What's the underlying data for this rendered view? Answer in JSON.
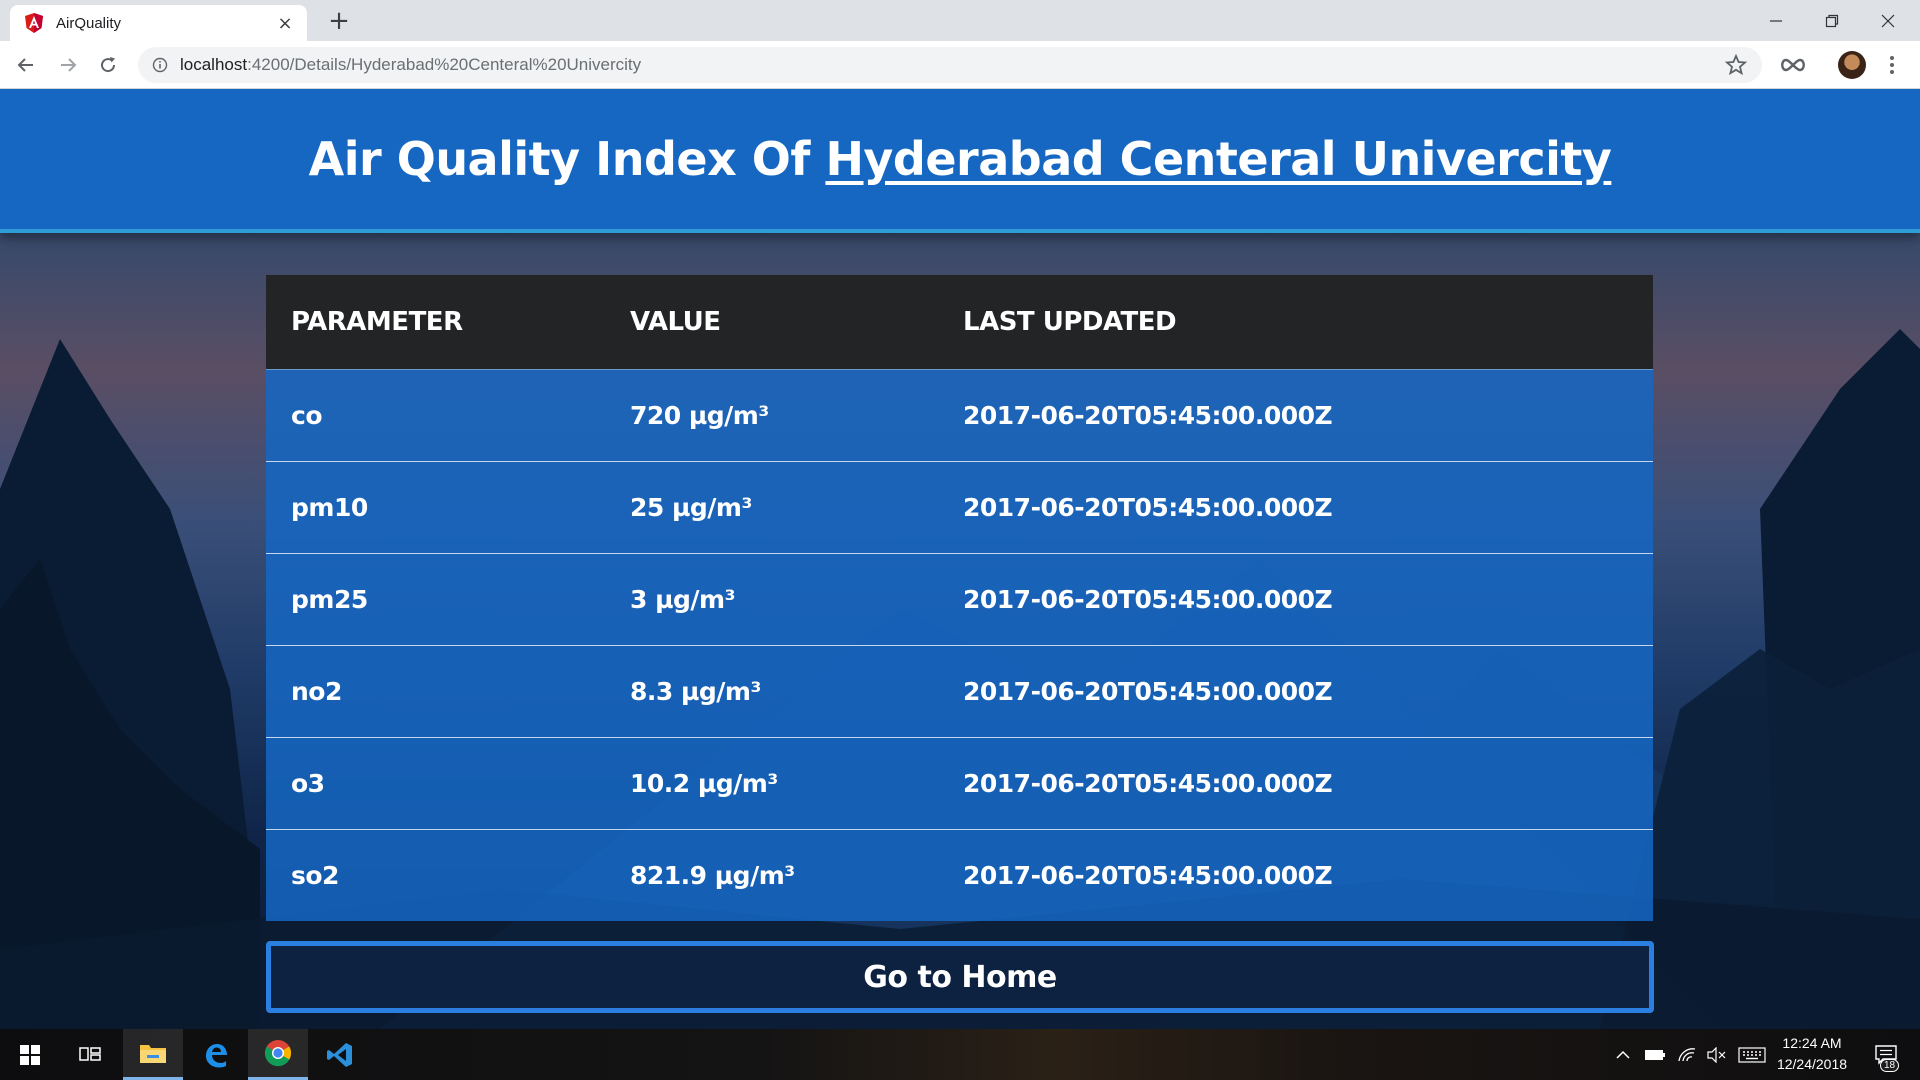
{
  "browser": {
    "tab_title": "AirQuality",
    "tab_close": "×",
    "new_tab": "+",
    "url_host": "localhost",
    "url_path": ":4200/Details/Hyderabad%20Centeral%20Univercity"
  },
  "page": {
    "title_prefix": "Air Quality Index Of ",
    "title_city": "Hyderabad Centeral Univercity",
    "table": {
      "headers": [
        "PARAMETER",
        "VALUE",
        "LAST UPDATED"
      ],
      "rows": [
        {
          "parameter": "co",
          "value": "720 µg/m³",
          "last_updated": "2017-06-20T05:45:00.000Z"
        },
        {
          "parameter": "pm10",
          "value": "25 µg/m³",
          "last_updated": "2017-06-20T05:45:00.000Z"
        },
        {
          "parameter": "pm25",
          "value": "3 µg/m³",
          "last_updated": "2017-06-20T05:45:00.000Z"
        },
        {
          "parameter": "no2",
          "value": "8.3 µg/m³",
          "last_updated": "2017-06-20T05:45:00.000Z"
        },
        {
          "parameter": "o3",
          "value": "10.2 µg/m³",
          "last_updated": "2017-06-20T05:45:00.000Z"
        },
        {
          "parameter": "so2",
          "value": "821.9 µg/m³",
          "last_updated": "2017-06-20T05:45:00.000Z"
        }
      ]
    },
    "home_button": "Go to Home"
  },
  "taskbar": {
    "time": "12:24 AM",
    "date": "12/24/2018",
    "notification_count": "18"
  },
  "colors": {
    "header_bg": "#1567c2",
    "table_header_bg": "#222426",
    "row_bg": "#1567c2",
    "button_border": "#2a7fe0"
  },
  "icons": [
    "angular-favicon",
    "back-arrow-icon",
    "forward-arrow-icon",
    "reload-icon",
    "info-icon",
    "star-icon",
    "extension-icon",
    "profile-avatar",
    "menu-dots-icon",
    "windows-start-icon",
    "task-view-icon",
    "file-explorer-icon",
    "edge-icon",
    "chrome-icon",
    "vscode-icon",
    "chevron-up-icon",
    "battery-icon",
    "wifi-icon",
    "volume-muted-icon",
    "keyboard-icon",
    "notification-icon"
  ]
}
